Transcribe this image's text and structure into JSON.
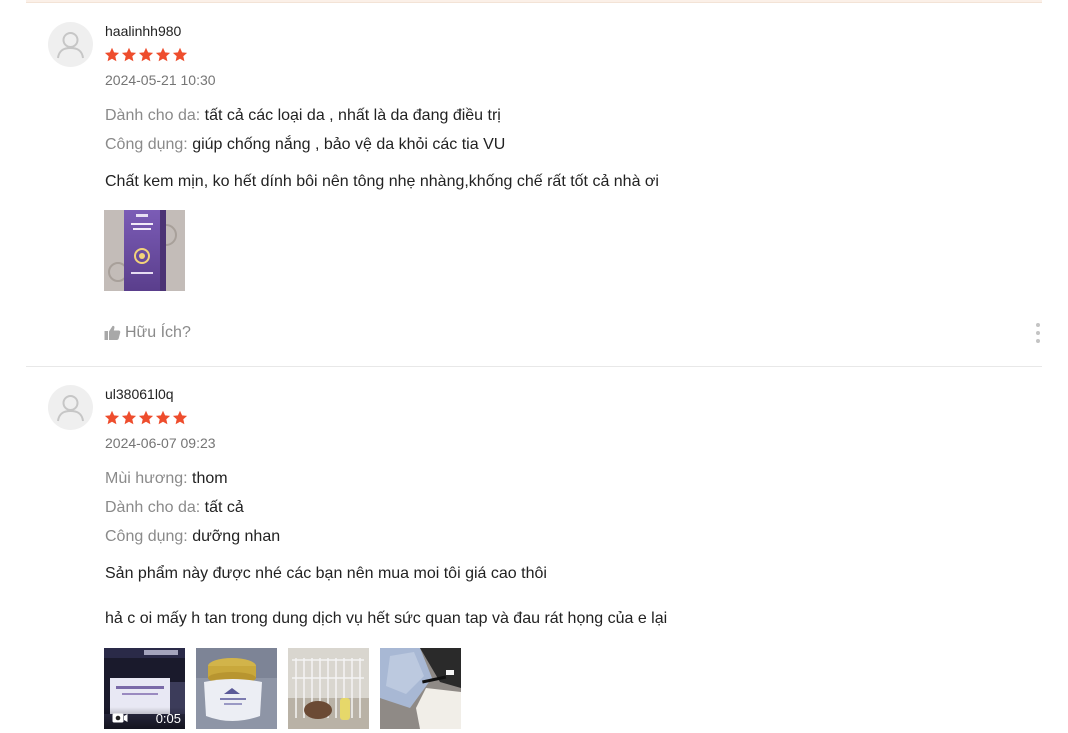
{
  "reviews": [
    {
      "username": "haalinhh980",
      "rating": 5,
      "date": "2024-05-21 10:30",
      "attributes": [
        {
          "label": "Dành cho da:",
          "value": "tất cả các loại da , nhất là da đang điều trị"
        },
        {
          "label": "Công dụng:",
          "value": "giúp chống nắng , bảo vệ  da khỏi các tia VU"
        }
      ],
      "paragraphs": [
        "Chất kem mịn, ko hết dính bôi nên tông nhẹ nhàng,khống chế rất tốt cả nhà ơi"
      ],
      "helpful_label": "Hữu Ích?"
    },
    {
      "username": "ul38061l0q",
      "rating": 5,
      "date": "2024-06-07 09:23",
      "attributes": [
        {
          "label": "Mùi hương:",
          "value": "thom"
        },
        {
          "label": "Dành cho da:",
          "value": "tất cả"
        },
        {
          "label": "Công dụng:",
          "value": "dưỡng nhan"
        }
      ],
      "paragraphs": [
        "Sản phẩm này được nhé các bạn nên mua moi tôi giá cao thôi",
        "hả c oi mấy h tan trong dung dịch vụ hết sức quan tap và đau rát họng của e lại"
      ],
      "video_duration": "0:05"
    }
  ],
  "colors": {
    "star": "#ee4d2d",
    "label": "#8a8a8a",
    "date": "#757575"
  }
}
